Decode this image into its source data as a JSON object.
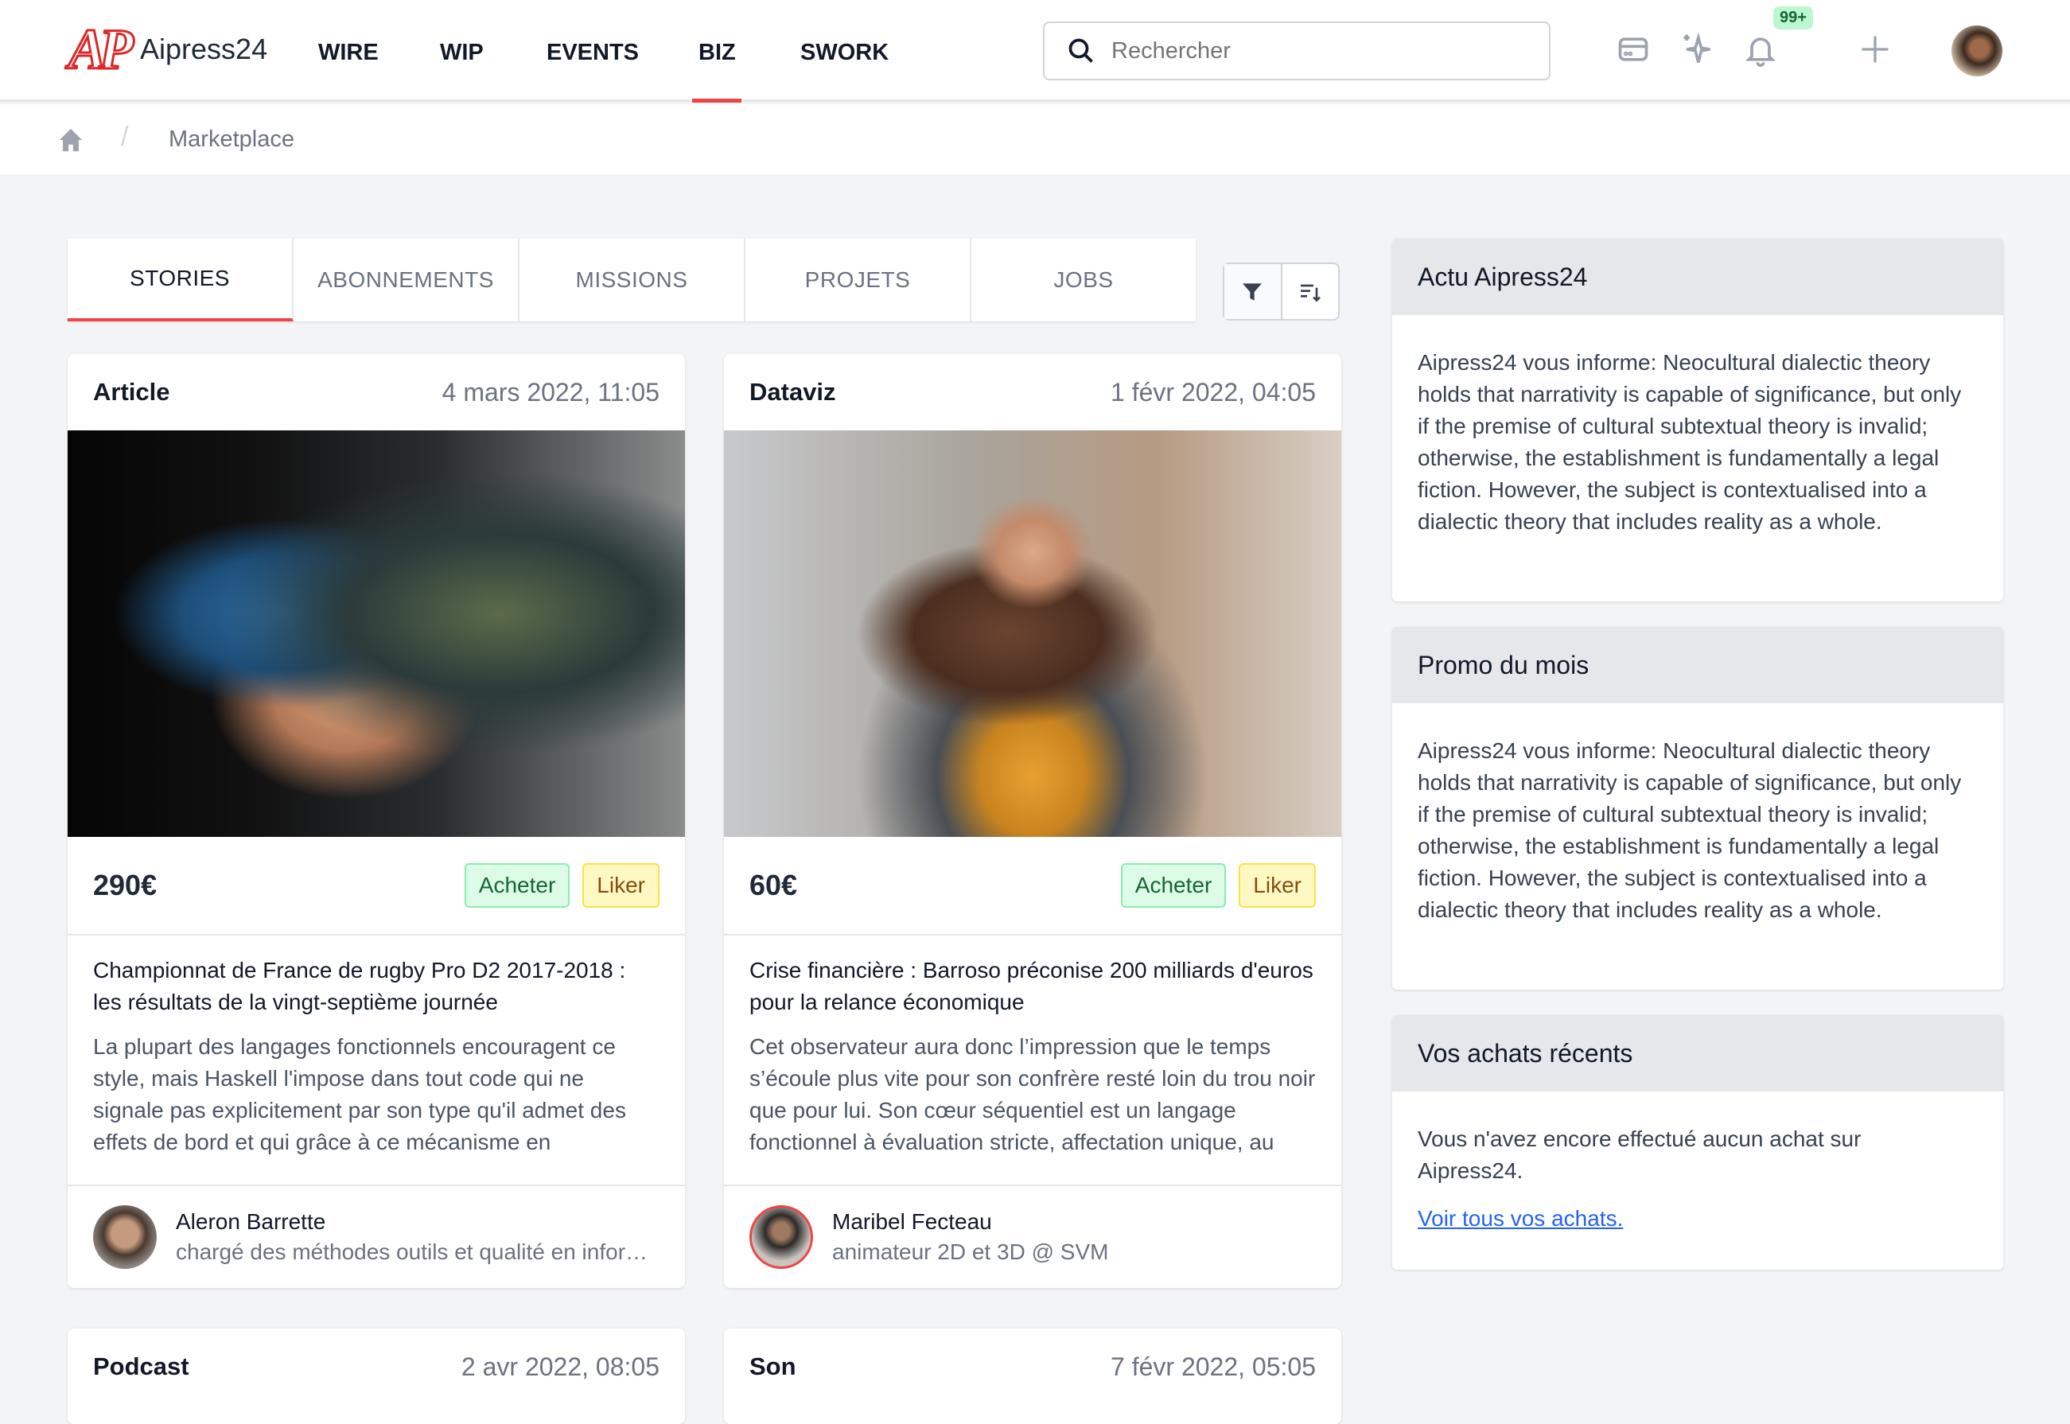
{
  "header": {
    "logo_mark": "AP",
    "brand": "Aipress24",
    "nav": [
      "WIRE",
      "WIP",
      "EVENTS",
      "BIZ",
      "SWORK"
    ],
    "active_nav": "BIZ",
    "search_placeholder": "Rechercher",
    "notifications_badge": "99+",
    "icons": [
      "wallet-icon",
      "sparkles-icon",
      "bell-icon",
      "plus-icon"
    ]
  },
  "breadcrumb": {
    "current": "Marketplace"
  },
  "tabs": [
    "STORIES",
    "ABONNEMENTS",
    "MISSIONS",
    "PROJETS",
    "JOBS"
  ],
  "active_tab": "STORIES",
  "cards": [
    {
      "type": "Article",
      "date": "4 mars 2022, 11:05",
      "price": "290€",
      "buy": "Acheter",
      "like": "Liker",
      "title": "Championnat de France de rugby Pro D2 2017-2018 : les résultats de la vingt-septième journée",
      "excerpt": "La plupart des langages fonctionnels encouragent ce style, mais Haskell l'impose dans tout code qui ne signale pas explicitement par son type qu'il admet des effets de bord et qui grâce à ce mécanisme en",
      "author": "Aleron Barrette",
      "role": "chargé des méthodes outils et qualité en informatique"
    },
    {
      "type": "Dataviz",
      "date": "1 févr 2022, 04:05",
      "price": "60€",
      "buy": "Acheter",
      "like": "Liker",
      "title": "Crise financière : Barroso préconise 200 milliards d'euros pour la relance économique",
      "excerpt": "Cet observateur aura donc l’impression que le temps s’écoule plus vite pour son confrère resté loin du trou noir que pour lui. Son cœur séquentiel est un langage fonctionnel à évaluation stricte, affectation unique, au",
      "author": "Maribel Fecteau",
      "role": "animateur 2D et 3D @ SVM"
    },
    {
      "type": "Podcast",
      "date": "2 avr 2022, 08:05"
    },
    {
      "type": "Son",
      "date": "7 févr 2022, 05:05"
    }
  ],
  "sidebar": {
    "panels": [
      {
        "title": "Actu Aipress24",
        "body": "Aipress24 vous informe: Neocultural dialectic theory holds that narrativity is capable of significance, but only if the premise of cultural subtextual theory is invalid; otherwise, the establishment is fundamentally a legal fiction. However, the subject is contextualised into a dialectic theory that includes reality as a whole."
      },
      {
        "title": "Promo du mois",
        "body": "Aipress24 vous informe: Neocultural dialectic theory holds that narrativity is capable of significance, but only if the premise of cultural subtextual theory is invalid; otherwise, the establishment is fundamentally a legal fiction. However, the subject is contextualised into a dialectic theory that includes reality as a whole."
      },
      {
        "title": "Vos achats récents",
        "body": "Vous n'avez encore effectué aucun achat sur Aipress24.",
        "link": "Voir tous vos achats."
      }
    ]
  },
  "colors": {
    "accent": "#ef4444",
    "buy_bg": "#dcfce7",
    "like_bg": "#fef9c3",
    "link": "#2563eb"
  }
}
